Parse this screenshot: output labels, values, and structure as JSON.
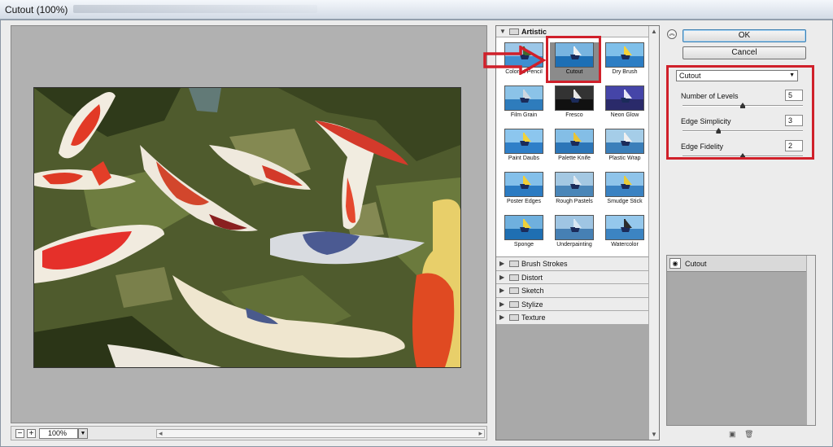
{
  "window": {
    "title": "Cutout (100%)"
  },
  "zoom": {
    "value": "100%",
    "minus_label": "−",
    "plus_label": "+"
  },
  "gallery": {
    "open_category": "Artistic",
    "filters": [
      {
        "label": "Colored Pencil",
        "selected": false
      },
      {
        "label": "Cutout",
        "selected": true
      },
      {
        "label": "Dry Brush",
        "selected": false
      },
      {
        "label": "Film Grain",
        "selected": false
      },
      {
        "label": "Fresco",
        "selected": false
      },
      {
        "label": "Neon Glow",
        "selected": false
      },
      {
        "label": "Paint Daubs",
        "selected": false
      },
      {
        "label": "Palette Knife",
        "selected": false
      },
      {
        "label": "Plastic Wrap",
        "selected": false
      },
      {
        "label": "Poster Edges",
        "selected": false
      },
      {
        "label": "Rough Pastels",
        "selected": false
      },
      {
        "label": "Smudge Stick",
        "selected": false
      },
      {
        "label": "Sponge",
        "selected": false
      },
      {
        "label": "Underpainting",
        "selected": false
      },
      {
        "label": "Watercolor",
        "selected": false
      }
    ],
    "collapsed_categories": [
      "Brush Strokes",
      "Distort",
      "Sketch",
      "Stylize",
      "Texture"
    ]
  },
  "buttons": {
    "ok": "OK",
    "cancel": "Cancel"
  },
  "settings": {
    "filter_select": "Cutout",
    "number_of_levels": {
      "label": "Number of Levels",
      "value": "5",
      "level": 0.5
    },
    "edge_simplicity": {
      "label": "Edge Simplicity",
      "value": "3",
      "level": 0.3
    },
    "edge_fidelity": {
      "label": "Edge Fidelity",
      "value": "2",
      "level": 0.5
    }
  },
  "layers": {
    "items": [
      {
        "name": "Cutout"
      }
    ]
  },
  "colors": {
    "annotation_red": "#d0202a",
    "ok_border": "#3c7fb1"
  }
}
